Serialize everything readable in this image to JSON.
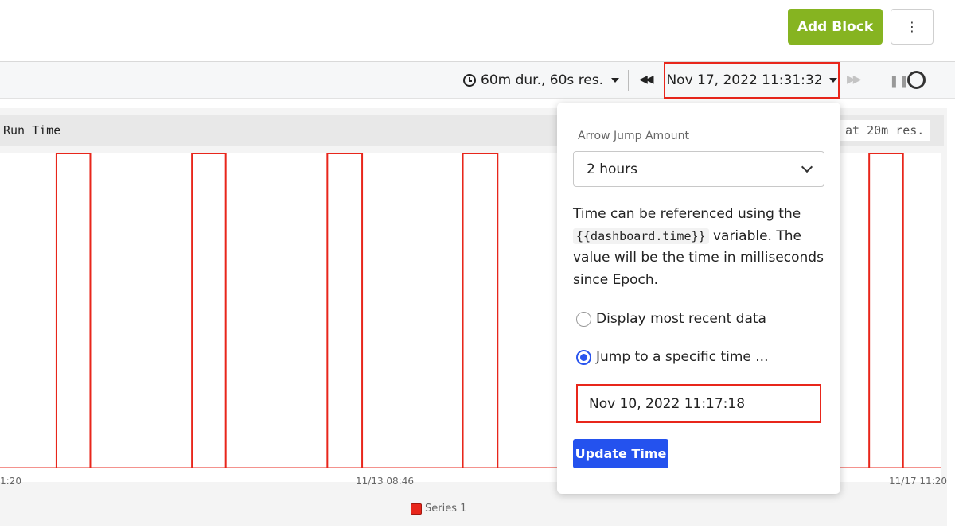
{
  "header": {
    "add_block_label": "Add Block",
    "more_icon": "⋮"
  },
  "toolbar": {
    "duration_label": "60m dur., 60s res.",
    "current_time": "Nov 17, 2022 11:31:32"
  },
  "chart_panel": {
    "title": "Run Time",
    "resolution_label": "at 20m res.",
    "x_tick_labels": [
      "1:20",
      "11/13 08:46",
      "11/17 11:20"
    ],
    "legend_label": "Series 1",
    "series_color": "#e8261b"
  },
  "chart_data": {
    "type": "line",
    "x_tick_labels": [
      "1:20",
      "11/13 08:46",
      "11/17 11:20"
    ],
    "series": [
      {
        "name": "Series 1",
        "color": "#e8261b",
        "pulses": [
          {
            "start": 0.06,
            "end": 0.096
          },
          {
            "start": 0.204,
            "end": 0.24
          },
          {
            "start": 0.348,
            "end": 0.385
          },
          {
            "start": 0.492,
            "end": 0.529
          },
          {
            "start": 0.924,
            "end": 0.96
          }
        ]
      }
    ]
  },
  "popover": {
    "jump_amount_label": "Arrow Jump Amount",
    "jump_amount_value": "2 hours",
    "info_text_before": "Time can be referenced using the",
    "info_code": "{{dashboard.time}}",
    "info_text_after": "variable. The value will be the time in milliseconds since Epoch.",
    "option_recent": "Display most recent data",
    "option_specific": "Jump to a specific time ...",
    "specific_time_value": "Nov 10, 2022 11:17:18",
    "update_button_label": "Update Time"
  }
}
